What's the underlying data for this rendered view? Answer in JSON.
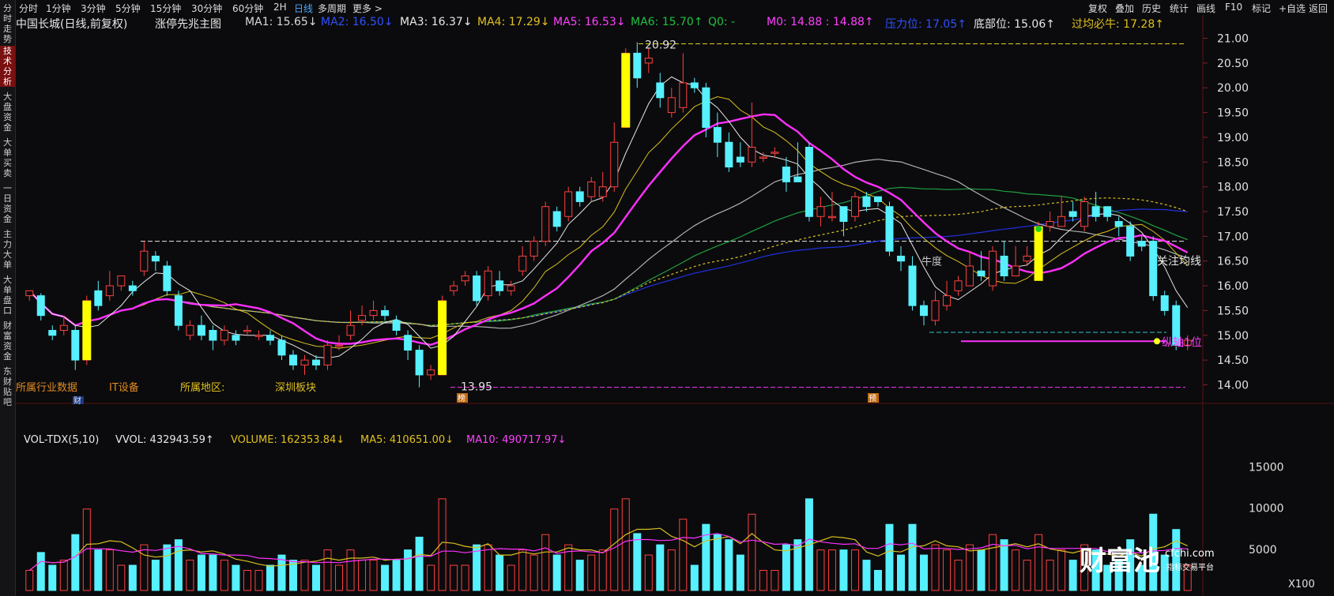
{
  "sidebar": {
    "items": [
      {
        "label": "分时走势",
        "active": false
      },
      {
        "label": "技术分析",
        "active": true
      },
      {
        "label": "大盘资金",
        "active": false
      },
      {
        "label": "大单买卖",
        "active": false
      },
      {
        "label": "一日资金",
        "active": false
      },
      {
        "label": "主力大单",
        "active": false
      },
      {
        "label": "大单盘口",
        "active": false
      },
      {
        "label": "财富资金",
        "active": false
      },
      {
        "label": "东财贴吧",
        "active": false
      }
    ]
  },
  "toolbar": {
    "periods": [
      "分时",
      "1分钟",
      "3分钟",
      "5分钟",
      "15分钟",
      "30分钟",
      "60分钟",
      "2H",
      "日线",
      "多周期",
      "更多 >"
    ],
    "active_period": "日线",
    "right_menu": [
      "复权",
      "叠加",
      "历史",
      "统计",
      "画线",
      "F10",
      "标记",
      "+自选",
      "返回"
    ]
  },
  "info": {
    "stock": "中国长城(日线,前复权)",
    "subchart": "涨停先兆主图",
    "ma1": "MA1: 15.65↓",
    "ma2": "MA2: 16.50↓",
    "ma3": "MA3: 16.37↓",
    "ma4": "MA4: 17.29↓",
    "ma5": "MA5: 16.53↓",
    "ma6": "MA6: 15.70↑",
    "q0": "Q0: -",
    "m0": "M0: 14.88 : 14.88↑",
    "pressure": "压力位: 17.05↑",
    "bottom": "底部位: 15.06↑",
    "guojun": "过均必牛: 17.28↑"
  },
  "annotations": {
    "high_label": "20.92",
    "low_label": "13.95",
    "guanzhu": "关注均线",
    "niudu": "牛度",
    "zongzhou": "纵轴1位",
    "industry": "所属行业数据",
    "industry_val": "IT设备",
    "region": "所属地区:",
    "region_val": "深圳板块",
    "marker_cai": "财",
    "marker_bang": "榜",
    "marker_yu": "预"
  },
  "price_axis": [
    "21.00",
    "20.50",
    "20.00",
    "19.50",
    "19.00",
    "18.50",
    "18.00",
    "17.50",
    "17.00",
    "16.50",
    "16.00",
    "15.50",
    "15.00",
    "14.50",
    "14.00"
  ],
  "volume": {
    "header": {
      "name": "VOL-TDX(5,10)",
      "vvol": "VVOL: 432943.59↑",
      "volume": "VOLUME: 162353.84↓",
      "ma5": "MA5: 410651.00↓",
      "ma10": "MA10: 490717.97↓"
    },
    "axis": [
      "15000",
      "10000",
      "5000"
    ],
    "unit": "X100"
  },
  "watermark": {
    "brand": "财富池",
    "site": "cfchi.com",
    "tag": "指标交易平台"
  },
  "colors": {
    "up": "#ff4040",
    "down": "#56f0ff",
    "signal": "#ffff00",
    "ma_white": "#e8e8e8",
    "ma_yellow": "#d8c020",
    "ma_magenta": "#ff30ff",
    "ma_green": "#20a040",
    "ma_blue": "#2030e0",
    "gridline": "#3a0a0a"
  },
  "chart_data": {
    "type": "candlestick",
    "ylim": [
      13.8,
      21.2
    ],
    "candles": [
      [
        15.8,
        15.9,
        15.9,
        15.7
      ],
      [
        15.8,
        15.4,
        15.85,
        15.3
      ],
      [
        15.1,
        15.0,
        15.2,
        14.9
      ],
      [
        15.1,
        15.2,
        15.4,
        15.0
      ],
      [
        15.1,
        14.5,
        15.2,
        14.3
      ],
      [
        14.5,
        15.7,
        15.8,
        14.4
      ],
      [
        15.9,
        15.6,
        16.1,
        15.5
      ],
      [
        15.8,
        16.0,
        16.3,
        15.7
      ],
      [
        16.0,
        16.2,
        16.2,
        15.9
      ],
      [
        16.0,
        15.9,
        16.1,
        15.8
      ],
      [
        16.3,
        16.7,
        16.9,
        16.2
      ],
      [
        16.6,
        16.5,
        16.7,
        16.3
      ],
      [
        16.4,
        15.9,
        16.5,
        15.8
      ],
      [
        15.8,
        15.2,
        15.9,
        15.1
      ],
      [
        15.0,
        15.2,
        15.3,
        14.9
      ],
      [
        15.2,
        15.0,
        15.4,
        14.9
      ],
      [
        15.1,
        14.9,
        15.2,
        14.7
      ],
      [
        14.9,
        15.1,
        15.2,
        14.8
      ],
      [
        15.0,
        14.9,
        15.1,
        14.8
      ],
      [
        15.1,
        15.1,
        15.2,
        15.0
      ],
      [
        15.0,
        15.0,
        15.1,
        14.9
      ],
      [
        15.0,
        14.9,
        15.1,
        14.8
      ],
      [
        14.9,
        14.6,
        15.0,
        14.5
      ],
      [
        14.6,
        14.4,
        14.7,
        14.3
      ],
      [
        14.4,
        14.5,
        14.6,
        14.2
      ],
      [
        14.5,
        14.4,
        14.6,
        14.3
      ],
      [
        14.4,
        14.8,
        14.9,
        14.3
      ],
      [
        14.8,
        14.8,
        15.0,
        14.7
      ],
      [
        15.0,
        15.2,
        15.5,
        14.9
      ],
      [
        15.3,
        15.4,
        15.6,
        15.2
      ],
      [
        15.4,
        15.5,
        15.7,
        15.3
      ],
      [
        15.5,
        15.4,
        15.6,
        15.3
      ],
      [
        15.3,
        15.1,
        15.4,
        15.0
      ],
      [
        15.0,
        14.7,
        15.1,
        14.5
      ],
      [
        14.7,
        14.2,
        14.8,
        13.95
      ],
      [
        14.2,
        14.3,
        14.4,
        14.1
      ],
      [
        14.2,
        15.7,
        15.8,
        14.2
      ],
      [
        15.9,
        16.0,
        16.1,
        15.8
      ],
      [
        16.1,
        16.2,
        16.3,
        16.0
      ],
      [
        16.2,
        15.7,
        16.3,
        15.6
      ],
      [
        15.8,
        16.3,
        16.4,
        15.7
      ],
      [
        16.1,
        15.9,
        16.3,
        15.8
      ],
      [
        15.9,
        16.0,
        16.1,
        15.8
      ],
      [
        16.3,
        16.6,
        16.8,
        16.2
      ],
      [
        16.6,
        16.9,
        17.0,
        16.5
      ],
      [
        16.9,
        17.6,
        17.7,
        16.8
      ],
      [
        17.5,
        17.2,
        17.6,
        17.1
      ],
      [
        17.4,
        17.9,
        18.0,
        17.3
      ],
      [
        17.9,
        17.7,
        18.0,
        17.6
      ],
      [
        17.8,
        18.1,
        18.2,
        17.7
      ],
      [
        17.8,
        18.0,
        18.3,
        17.7
      ],
      [
        18.0,
        18.9,
        19.3,
        17.9
      ],
      [
        19.2,
        20.7,
        20.8,
        19.2
      ],
      [
        20.7,
        20.2,
        20.92,
        20.0
      ],
      [
        20.5,
        20.6,
        20.8,
        20.3
      ],
      [
        20.1,
        19.8,
        20.3,
        19.6
      ],
      [
        19.5,
        19.8,
        20.0,
        19.4
      ],
      [
        19.6,
        20.1,
        20.7,
        19.5
      ],
      [
        20.1,
        20.0,
        20.2,
        19.9
      ],
      [
        20.0,
        19.2,
        20.1,
        19.0
      ],
      [
        19.2,
        18.9,
        19.5,
        18.6
      ],
      [
        18.9,
        18.4,
        19.1,
        18.3
      ],
      [
        18.6,
        18.5,
        18.9,
        18.4
      ],
      [
        18.5,
        18.8,
        19.7,
        18.4
      ],
      [
        18.6,
        18.6,
        18.7,
        18.5
      ],
      [
        18.7,
        18.7,
        18.8,
        18.6
      ],
      [
        18.4,
        18.1,
        18.6,
        17.9
      ],
      [
        18.2,
        18.1,
        18.9,
        18.1
      ],
      [
        18.8,
        17.4,
        18.9,
        17.3
      ],
      [
        17.4,
        17.6,
        17.8,
        17.2
      ],
      [
        17.4,
        17.4,
        17.9,
        17.3
      ],
      [
        17.6,
        17.3,
        17.6,
        17.0
      ],
      [
        17.4,
        17.8,
        17.9,
        17.3
      ],
      [
        17.8,
        17.6,
        17.9,
        17.5
      ],
      [
        17.8,
        17.7,
        17.8,
        17.6
      ],
      [
        17.6,
        16.7,
        17.7,
        16.6
      ],
      [
        16.6,
        16.5,
        16.8,
        16.3
      ],
      [
        16.4,
        15.6,
        16.6,
        15.5
      ],
      [
        15.6,
        15.4,
        15.7,
        15.2
      ],
      [
        15.3,
        15.7,
        15.9,
        15.2
      ],
      [
        15.6,
        15.8,
        16.1,
        15.5
      ],
      [
        15.9,
        16.1,
        16.2,
        15.8
      ],
      [
        16.0,
        16.4,
        16.7,
        16.0
      ],
      [
        16.3,
        16.2,
        16.7,
        16.1
      ],
      [
        16.0,
        16.7,
        16.8,
        15.9
      ],
      [
        16.6,
        16.2,
        16.9,
        16.1
      ],
      [
        16.2,
        16.4,
        16.8,
        16.2
      ],
      [
        16.5,
        16.6,
        16.8,
        16.4
      ],
      [
        16.5,
        17.2,
        17.3,
        16.4
      ],
      [
        17.2,
        17.3,
        17.5,
        17.1
      ],
      [
        17.2,
        17.4,
        17.8,
        17.2
      ],
      [
        17.5,
        17.4,
        17.7,
        17.3
      ],
      [
        17.2,
        17.7,
        17.8,
        17.1
      ],
      [
        17.6,
        17.4,
        17.9,
        17.3
      ],
      [
        17.6,
        17.4,
        17.6,
        17.3
      ],
      [
        17.3,
        17.2,
        17.4,
        17.0
      ],
      [
        17.2,
        16.6,
        17.3,
        16.5
      ],
      [
        16.9,
        16.8,
        17.0,
        16.7
      ],
      [
        16.9,
        15.8,
        17.0,
        15.7
      ],
      [
        15.8,
        15.5,
        15.9,
        15.4
      ],
      [
        15.6,
        14.8,
        15.7,
        14.7
      ],
      [
        14.8,
        14.9,
        15.0,
        14.7
      ]
    ],
    "signal_bars": [
      [
        15.7,
        14.5
      ],
      [
        15.7,
        14.2
      ],
      [
        20.7,
        19.2
      ],
      [
        17.2,
        16.1
      ]
    ],
    "vol_ylim": [
      0,
      18000
    ]
  }
}
